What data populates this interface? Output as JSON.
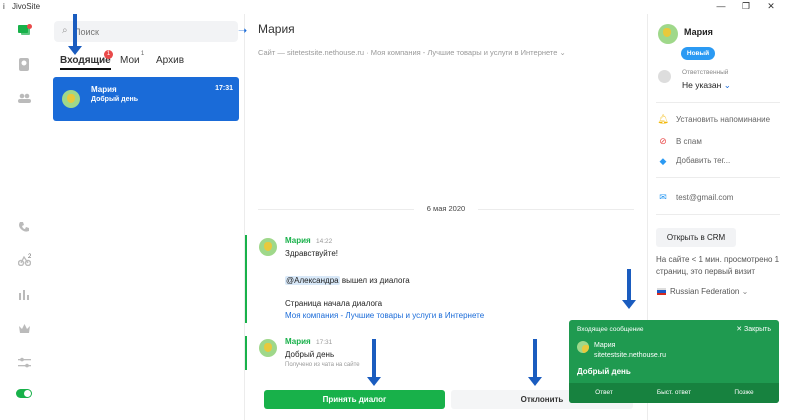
{
  "window": {
    "title": "JivoSite",
    "minimize": "—",
    "restore": "❐",
    "close": "✕"
  },
  "sidebar": {
    "chats_badge": "",
    "visitors_badge": "2"
  },
  "chatlist": {
    "search_placeholder": "Поиск",
    "tabs": [
      {
        "label": "Входящие",
        "badge": "1"
      },
      {
        "label": "Мои",
        "badge": "1"
      },
      {
        "label": "Архив",
        "badge": ""
      }
    ],
    "items": [
      {
        "name": "Мария",
        "time": "17:31",
        "preview": "Добрый день"
      }
    ]
  },
  "conversation": {
    "title": "Мария",
    "site_line": "Сайт — sitetestsite.nethouse.ru · Моя компания - Лучшие товары и услуги в Интернете ⌄",
    "date": "6 мая 2020",
    "messages": [
      {
        "name": "Мария",
        "time": "14:22",
        "text": "Здравствуйте!",
        "mention": "@Александра",
        "mention_suffix": " вышел из диалога",
        "page_label": "Страница начала диалога",
        "page_link": "Моя компания - Лучшие товары и услуги в Интернете"
      },
      {
        "name": "Мария",
        "time": "17:31",
        "text": "Добрый день",
        "note": "Получено из чата на сайте"
      }
    ],
    "accept_label": "Принять диалог",
    "decline_label": "Отклонить"
  },
  "details": {
    "name": "Мария",
    "badge": "Новый",
    "responsible_label": "Ответственный",
    "responsible_value": "Не указан",
    "actions": [
      "Установить напоминание",
      "В спам",
      "Добавить тег..."
    ],
    "email": "test@gmail.com",
    "crm_button": "Открыть в CRM",
    "visit_info": "На сайте < 1 мин. просмотрено 1 страниц, это первый визит",
    "country": "Russian Federation",
    "colors": {
      "accent": "#1a6bd8",
      "green": "#18b14a",
      "notif": "#1f9a50"
    }
  },
  "notification": {
    "header": "Входящее сообщение",
    "close": "Закрыть",
    "name": "Мария",
    "site": "sitetestsite.nethouse.ru",
    "text": "Добрый день",
    "actions": [
      "Ответ",
      "Быст. ответ",
      "Позже"
    ]
  }
}
